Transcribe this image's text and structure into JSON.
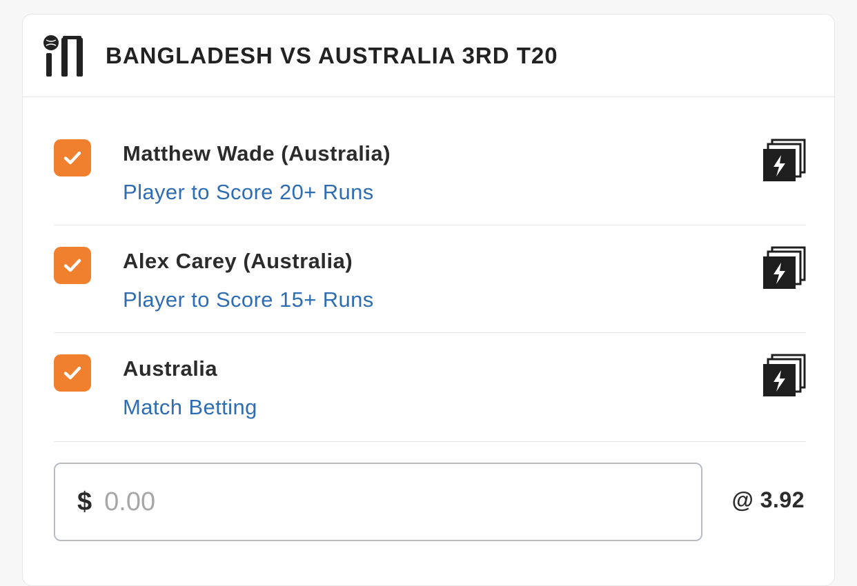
{
  "header": {
    "icon": "cricket-icon",
    "title": "BANGLADESH VS AUSTRALIA 3RD T20"
  },
  "legs": [
    {
      "selection": "Matthew Wade (Australia)",
      "market": "Player to Score 20+ Runs",
      "checked": true,
      "icon": "same-game-multi-icon"
    },
    {
      "selection": "Alex Carey (Australia)",
      "market": "Player to Score 15+ Runs",
      "checked": true,
      "icon": "same-game-multi-icon"
    },
    {
      "selection": "Australia",
      "market": "Match Betting",
      "checked": true,
      "icon": "same-game-multi-icon"
    }
  ],
  "stake": {
    "currency": "$",
    "placeholder": "0.00",
    "value": ""
  },
  "odds": "@ 3.92",
  "colors": {
    "checkbox": "#f07f2e",
    "market_link": "#2f6db3",
    "text": "#2b2b2b"
  }
}
